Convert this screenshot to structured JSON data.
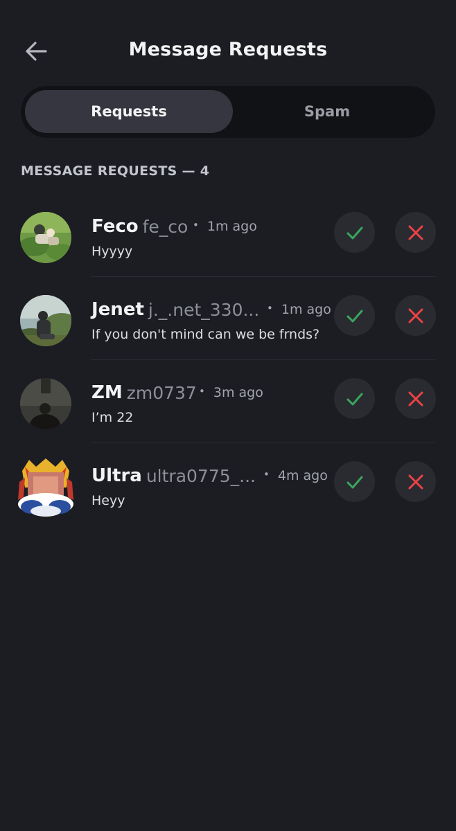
{
  "header": {
    "title": "Message Requests",
    "back_icon": "arrow-left-icon"
  },
  "tabs": [
    {
      "label": "Requests",
      "active": true
    },
    {
      "label": "Spam",
      "active": false
    }
  ],
  "section": {
    "title": "MESSAGE REQUESTS — 4"
  },
  "colors": {
    "background": "#1c1d22",
    "accept": "#3ba55d",
    "decline": "#ed4245"
  },
  "requests": [
    {
      "display_name": "Feco",
      "username": "fe_co",
      "time": "1m ago",
      "message": "Hyyyy"
    },
    {
      "display_name": "Jenet",
      "username": "j._.net_330...",
      "time": "1m ago",
      "message": "If you don't mind can we be frnds?"
    },
    {
      "display_name": "ZM",
      "username": "zm0737",
      "time": "3m ago",
      "message": "I’m 22"
    },
    {
      "display_name": "Ultra",
      "username": "ultra0775_...",
      "time": "4m ago",
      "message": "Heyy"
    }
  ]
}
